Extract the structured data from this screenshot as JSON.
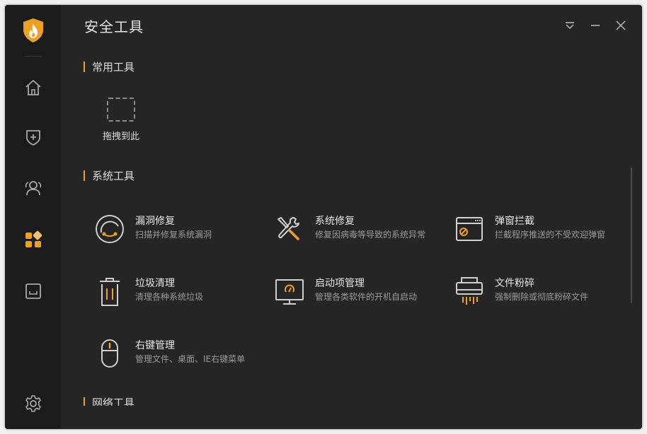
{
  "app": {
    "title": "安全工具"
  },
  "colors": {
    "accent": "#f0a020",
    "background": "#252525",
    "sidebar": "#1b1b1b"
  },
  "sidebar": {
    "items": [
      {
        "icon": "home-icon"
      },
      {
        "icon": "shield-plus-icon"
      },
      {
        "icon": "users-icon"
      },
      {
        "icon": "apps-icon",
        "active": true
      },
      {
        "icon": "tray-icon"
      }
    ],
    "settings_icon": "gear-icon"
  },
  "window_controls": [
    "menu-icon",
    "minimize-icon",
    "close-icon"
  ],
  "common_tools": {
    "title": "常用工具",
    "drop_label": "拖拽到此"
  },
  "system_tools": {
    "title": "系统工具",
    "items": [
      {
        "name": "漏洞修复",
        "desc": "扫描并修复系统漏洞",
        "icon": "vulnerability-fix-icon"
      },
      {
        "name": "系统修复",
        "desc": "修复因病毒等导致的系统异常",
        "icon": "wrench-screwdriver-icon"
      },
      {
        "name": "弹窗拦截",
        "desc": "拦截程序推送的不受欢迎弹窗",
        "icon": "popup-block-icon"
      },
      {
        "name": "垃圾清理",
        "desc": "清理各种系统垃圾",
        "icon": "trash-icon"
      },
      {
        "name": "启动项管理",
        "desc": "管理各类软件的开机自启动",
        "icon": "startup-monitor-icon"
      },
      {
        "name": "文件粉碎",
        "desc": "强制删除或彻底粉碎文件",
        "icon": "shredder-icon"
      },
      {
        "name": "右键管理",
        "desc": "管理文件、桌面、IE右键菜单",
        "icon": "mouse-icon"
      }
    ]
  },
  "network_tools": {
    "title": "网络工具"
  }
}
